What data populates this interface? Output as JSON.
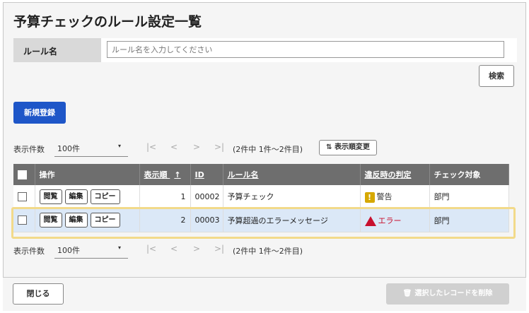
{
  "page": {
    "title": "予算チェックのルール設定一覧"
  },
  "search": {
    "label": "ルール名",
    "placeholder": "ルール名を入力してください",
    "button": "検索"
  },
  "actions": {
    "new_label": "新規登録"
  },
  "pager": {
    "count_label": "表示件数",
    "count_value": "100件",
    "caret": "▾",
    "nav": {
      "first": "|<",
      "prev": "<",
      "next": ">",
      "last": ">|"
    },
    "summary": "(2件中 1件〜2件目)",
    "reorder_label": "表示順変更",
    "reorder_icon": "⇅"
  },
  "table": {
    "headers": [
      "操作",
      "表示順",
      "ID",
      "ルール名",
      "違反時の判定",
      "チェック対象"
    ],
    "sort_arrow": "↑",
    "row_buttons": [
      "閲覧",
      "編集",
      "コピー"
    ],
    "rows": [
      {
        "order": "1",
        "id": "00002",
        "name": "予算チェック",
        "judge_icon": "!",
        "judge": "警告",
        "target": "部門"
      },
      {
        "order": "2",
        "id": "00003",
        "name": "予算超過のエラーメッセージ",
        "judge_icon": "!",
        "judge": "エラー",
        "target": "部門"
      }
    ]
  },
  "footer": {
    "close_label": "閉じる",
    "delete_label": "選択したレコードを削除",
    "delete_icon": "🗑"
  },
  "colors": {
    "primary": "#1e56c8",
    "warning": "#d6a800",
    "error": "#c8102e",
    "selected_row": "#dbe8f7",
    "highlight": "#f2da8a"
  }
}
